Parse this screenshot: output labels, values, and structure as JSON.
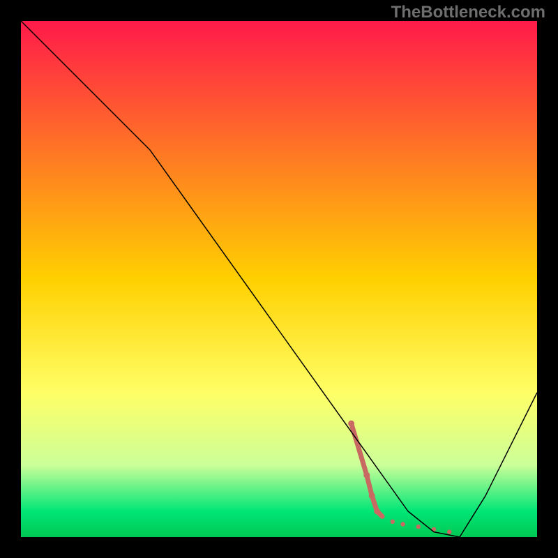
{
  "watermark": "TheBottleneck.com",
  "chart_data": {
    "type": "line",
    "title": "",
    "xlabel": "",
    "ylabel": "",
    "xlim": [
      0,
      100
    ],
    "ylim": [
      0,
      100
    ],
    "background_gradient": {
      "stops": [
        {
          "offset": 0.0,
          "color": "#ff1a4a"
        },
        {
          "offset": 0.5,
          "color": "#ffd000"
        },
        {
          "offset": 0.72,
          "color": "#ffff66"
        },
        {
          "offset": 0.86,
          "color": "#ccff99"
        },
        {
          "offset": 0.95,
          "color": "#00e676"
        },
        {
          "offset": 1.0,
          "color": "#00c853"
        }
      ]
    },
    "series": [
      {
        "name": "bottleneck-curve",
        "color": "#000000",
        "width": 1.5,
        "x": [
          0,
          10,
          20,
          25,
          30,
          40,
          50,
          60,
          65,
          70,
          75,
          80,
          85,
          90,
          100
        ],
        "y": [
          100,
          90,
          80,
          75,
          68,
          54,
          40,
          26,
          19,
          12,
          5,
          1,
          0,
          8,
          28
        ]
      }
    ],
    "highlight_segment": {
      "name": "bottleneck-highlight",
      "color": "#c96a62",
      "width": 7,
      "points": [
        {
          "x": 64,
          "y": 22
        },
        {
          "x": 67,
          "y": 12
        },
        {
          "x": 68,
          "y": 8
        },
        {
          "x": 69,
          "y": 5
        },
        {
          "x": 70,
          "y": 4
        },
        {
          "x": 72,
          "y": 3
        },
        {
          "x": 74,
          "y": 2.5
        },
        {
          "x": 77,
          "y": 2
        },
        {
          "x": 80,
          "y": 1.5
        },
        {
          "x": 83,
          "y": 1
        }
      ]
    }
  }
}
